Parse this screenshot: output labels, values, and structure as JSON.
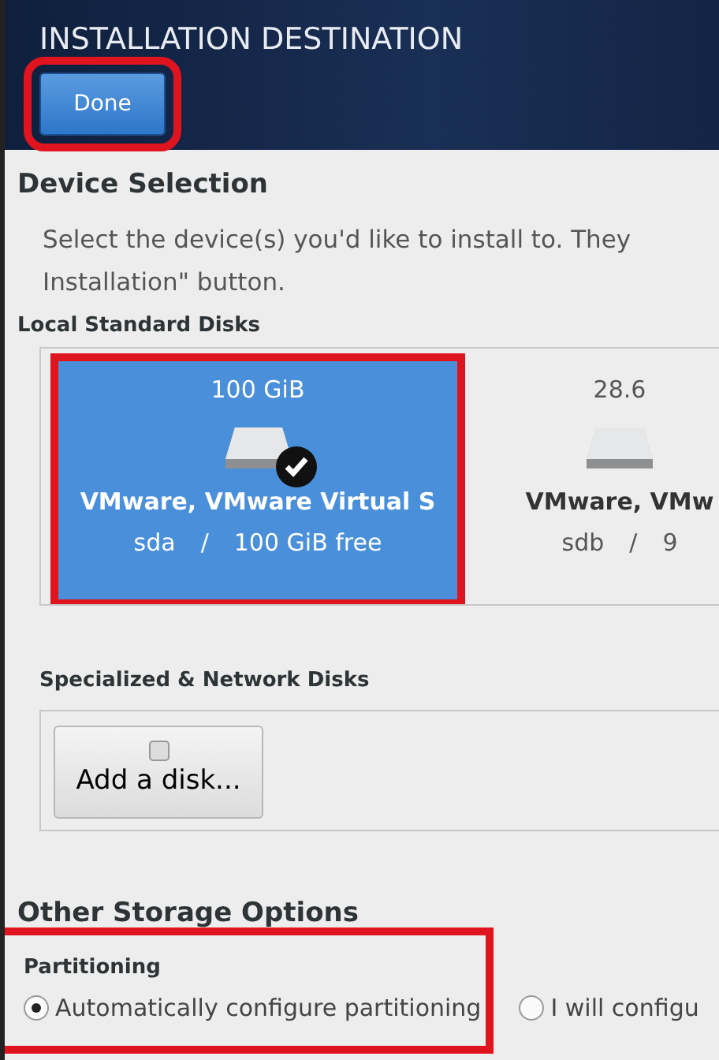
{
  "header": {
    "title": "INSTALLATION DESTINATION",
    "done_button": {
      "label": "Done",
      "highlighted": true
    }
  },
  "device_selection": {
    "heading": "Device Selection",
    "description_lines": [
      "Select the device(s) you'd like to install to.  They",
      "Installation\" button."
    ],
    "local_disks": {
      "heading": "Local Standard Disks",
      "disks": [
        {
          "size": "100 GiB",
          "name": "VMware, VMware Virtual S",
          "device": "sda",
          "separator": "/",
          "free": "100 GiB free",
          "selected": true,
          "highlighted": true
        },
        {
          "size": "28.6",
          "name": "VMware, VMw",
          "device": "sdb",
          "separator": "/",
          "free": "9",
          "selected": false,
          "highlighted": false
        }
      ]
    },
    "specialized_disks": {
      "heading": "Specialized & Network Disks",
      "add_button": {
        "label": "Add a disk..."
      }
    }
  },
  "other_storage": {
    "heading": "Other Storage Options",
    "partitioning": {
      "heading": "Partitioning",
      "highlighted": true,
      "options": [
        {
          "label": "Automatically configure partitioning",
          "selected": true
        },
        {
          "label": "I will configu",
          "selected": false
        }
      ]
    }
  }
}
